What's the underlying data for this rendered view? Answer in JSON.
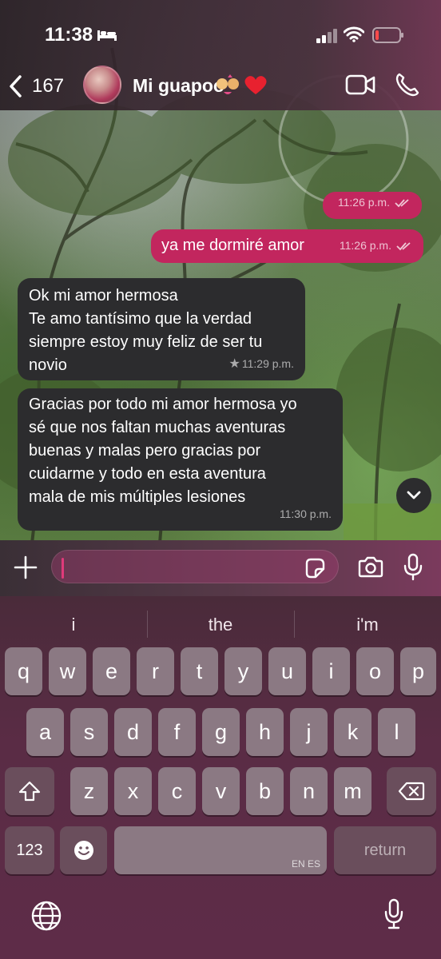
{
  "status_bar": {
    "time": "11:38",
    "icons": [
      "bed-icon",
      "signal-icon",
      "wifi-icon",
      "battery-low-icon"
    ],
    "battery_color": "#ff4b4b"
  },
  "header": {
    "back_count": "167",
    "contact_name": "Mi guapoo",
    "contact_emoji": "💏❤️",
    "icons": [
      "back-chevron-icon",
      "video-call-icon",
      "phone-icon"
    ]
  },
  "messages": [
    {
      "direction": "out",
      "text": "",
      "time": "11:26 p.m.",
      "status": "read"
    },
    {
      "direction": "out",
      "text": "ya me dormiré amor",
      "time": "11:26 p.m.",
      "status": "read"
    },
    {
      "direction": "in",
      "text": "Ok mi amor hermosa\nTe amo tantísimo que la verdad\nsiempre estoy muy feliz de ser tu\nnovio",
      "time": "11:29 p.m.",
      "starred": true
    },
    {
      "direction": "in",
      "text": "Gracias por todo mi amor hermosa yo\nsé que nos faltan muchas aventuras\nbuenas y malas pero gracias por\ncuidarme y todo en esta aventura\nmala de mis múltiples lesiones",
      "time": "11:30 p.m."
    }
  ],
  "composer": {
    "value": "",
    "icons": [
      "plus-icon",
      "sticker-icon",
      "camera-icon",
      "microphone-icon"
    ]
  },
  "keyboard": {
    "suggestions": [
      "i",
      "the",
      "i'm"
    ],
    "row1": [
      "q",
      "w",
      "e",
      "r",
      "t",
      "y",
      "u",
      "i",
      "o",
      "p"
    ],
    "row2": [
      "a",
      "s",
      "d",
      "f",
      "g",
      "h",
      "j",
      "k",
      "l"
    ],
    "row3": [
      "z",
      "x",
      "c",
      "v",
      "b",
      "n",
      "m"
    ],
    "numbers_label": "123",
    "space_languages": "EN ES",
    "return_label": "return",
    "icons": [
      "shift-icon",
      "delete-icon",
      "emoji-icon",
      "globe-icon",
      "dictation-icon"
    ]
  },
  "colors": {
    "outgoing_bubble": "#c2265e",
    "incoming_bubble": "#2c2c2e",
    "accent": "#e03a7a"
  }
}
